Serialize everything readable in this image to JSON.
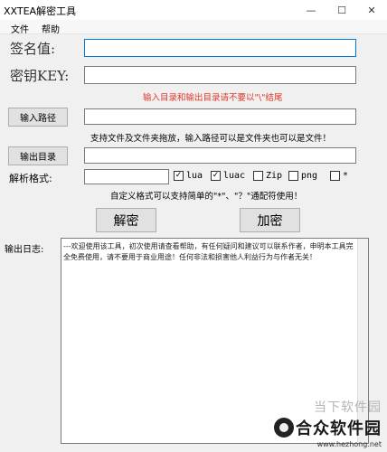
{
  "window": {
    "title": "XXTEA解密工具",
    "minimize_glyph": "—",
    "maximize_glyph": "☐",
    "close_glyph": "✕"
  },
  "menu": {
    "items": [
      {
        "label": "文件"
      },
      {
        "label": "帮助"
      }
    ]
  },
  "form": {
    "signature_label": "签名值:",
    "signature_value": "",
    "key_label": "密钥KEY:",
    "key_value": "",
    "warning": "输入目录和输出目录请不要以\"\\\"结尾",
    "input_path_button": "输入路径",
    "input_path_value": "",
    "drag_hint": "支持文件及文件夹拖放，输入路径可以是文件夹也可以是文件！",
    "output_dir_button": "输出目录",
    "output_dir_value": "",
    "format_label": "解析格式:",
    "format_value": "",
    "formats": [
      {
        "label": "lua",
        "checked": true
      },
      {
        "label": "luac",
        "checked": true
      },
      {
        "label": "Zip",
        "checked": false
      },
      {
        "label": "png",
        "checked": false
      },
      {
        "label": "*",
        "checked": false
      }
    ],
    "custom_hint": "自定义格式可以支持简单的\"*\"、\"？\"通配符使用！",
    "decrypt_button": "解密",
    "encrypt_button": "加密"
  },
  "log": {
    "label": "输出日志:",
    "text": "---欢迎使用该工具，初次使用请查看帮助，有任何疑问和建议可以联系作者，申明本工具完全免费使用，请不要用于商业用途！任何非法和损害他人利益行为与作者无关！"
  },
  "watermark": {
    "top": "当下软件园",
    "name": "合众软件园",
    "url": "www.hezhong.net"
  }
}
